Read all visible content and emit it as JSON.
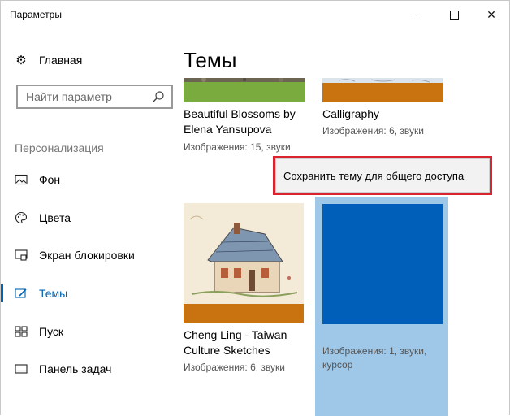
{
  "window": {
    "title": "Параметры",
    "minimize": "—",
    "maximize": "□",
    "close": "✕"
  },
  "sidebar": {
    "home_label": "Главная",
    "search_placeholder": "Найти параметр",
    "section_label": "Персонализация",
    "items": [
      {
        "label": "Фон",
        "icon": "picture-icon"
      },
      {
        "label": "Цвета",
        "icon": "palette-icon"
      },
      {
        "label": "Экран блокировки",
        "icon": "lock-screen-icon"
      },
      {
        "label": "Темы",
        "icon": "themes-icon",
        "active": true
      },
      {
        "label": "Пуск",
        "icon": "start-icon"
      },
      {
        "label": "Панель задач",
        "icon": "taskbar-icon"
      }
    ]
  },
  "main": {
    "title": "Темы",
    "themes": [
      {
        "name": "Beautiful Blossoms by Elena Yansupova",
        "name_line1": "Beautiful Blossoms by",
        "name_line2": "Elena Yansupova",
        "meta": "Изображения: 15, звуки",
        "accent": "#7aab3f"
      },
      {
        "name": "Calligraphy",
        "meta": "Изображения: 6, звуки",
        "accent": "#c87210"
      },
      {
        "name": "Cheng Ling - Taiwan Culture Sketches",
        "name_line1": "Cheng Ling - Taiwan",
        "name_line2": "Culture Sketches",
        "meta": "Изображения: 6, звуки",
        "accent": "#c87210"
      },
      {
        "name": "",
        "meta_line1": "Изображения: 1, звуки,",
        "meta_line2": "курсор",
        "accent": "#005fb8"
      }
    ],
    "context_menu": {
      "save_share": "Сохранить тему для общего доступа"
    }
  },
  "colors": {
    "accent": "#0063b1",
    "highlight_border": "#d9232f",
    "selected_tile": "#9ec7e8"
  }
}
